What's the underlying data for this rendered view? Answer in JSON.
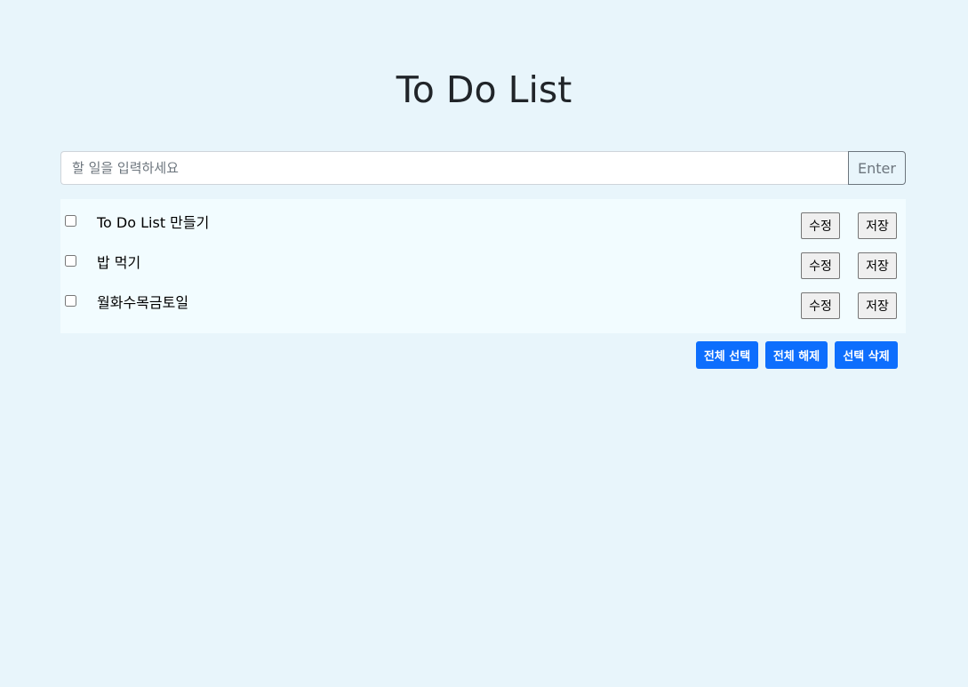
{
  "header": {
    "title": "To Do List"
  },
  "input": {
    "placeholder": "할 일을 입력하세요",
    "value": "",
    "enter_label": "Enter"
  },
  "todos": [
    {
      "text": "To Do List 만들기",
      "checked": false,
      "edit_label": "수정",
      "save_label": "저장"
    },
    {
      "text": "밥 먹기",
      "checked": false,
      "edit_label": "수정",
      "save_label": "저장"
    },
    {
      "text": "월화수목금토일",
      "checked": false,
      "edit_label": "수정",
      "save_label": "저장"
    }
  ],
  "actions": {
    "select_all": "전체 선택",
    "deselect_all": "전체 해제",
    "delete_selected": "선택 삭제"
  },
  "colors": {
    "background": "#e8f5fb",
    "list_background": "#f2fcff",
    "primary_button": "#0d6efd",
    "outline_button": "#6c757d"
  }
}
